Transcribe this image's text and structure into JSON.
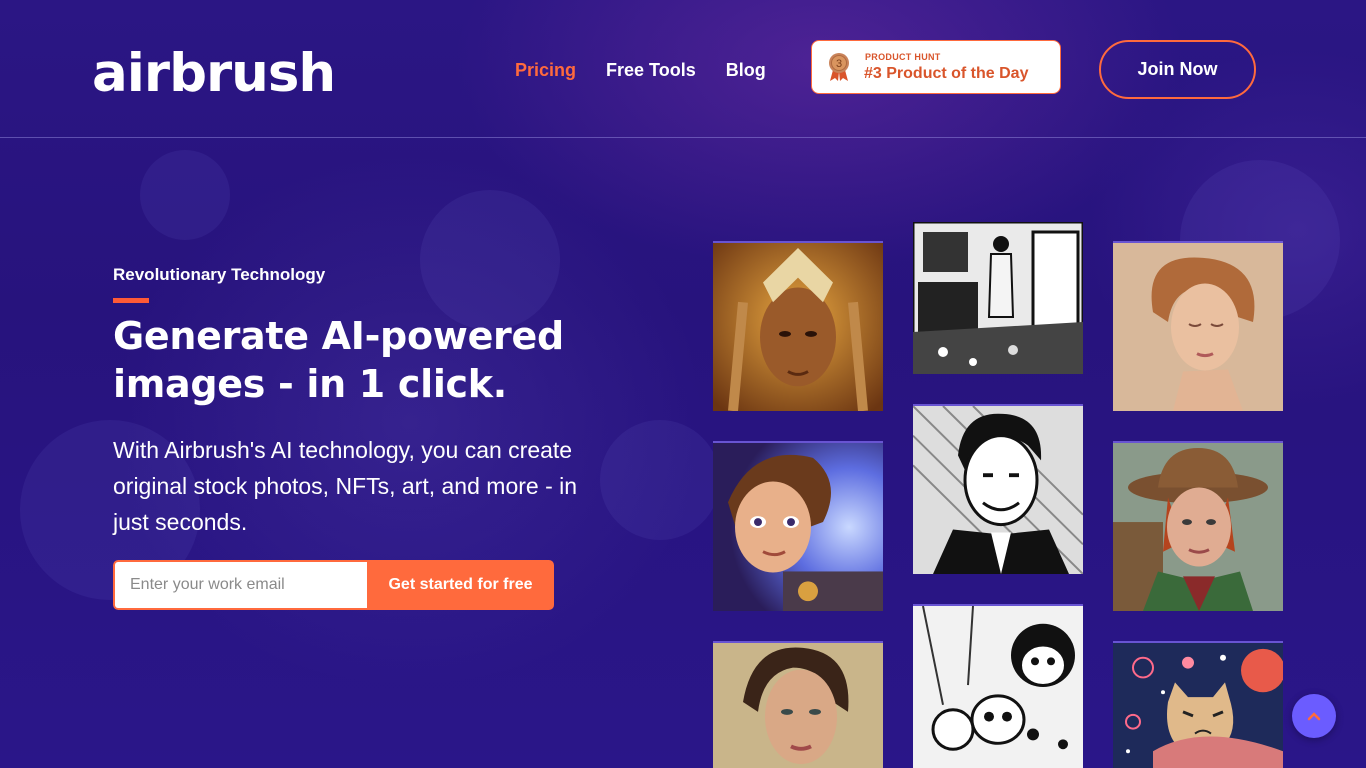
{
  "brand": {
    "logo_text": "airbrush"
  },
  "nav": {
    "items": [
      {
        "label": "Pricing",
        "active": true
      },
      {
        "label": "Free Tools",
        "active": false
      },
      {
        "label": "Blog",
        "active": false
      }
    ]
  },
  "product_hunt": {
    "kicker": "PRODUCT HUNT",
    "title": "#3 Product of the Day",
    "rank": "3"
  },
  "header_cta": {
    "label": "Join Now"
  },
  "hero": {
    "eyebrow": "Revolutionary Technology",
    "title": "Generate AI-powered images - in 1 click.",
    "subtitle": "With Airbrush's AI technology, you can create original stock photos, NFTs, art, and more - in just seconds.",
    "email_placeholder": "Enter your work email",
    "cta_label": "Get started for free"
  },
  "gallery": {
    "images": [
      {
        "name": "golden-warrior-woman-image"
      },
      {
        "name": "bw-kitchen-woman-sketch-image"
      },
      {
        "name": "redhead-woman-portrait-image"
      },
      {
        "name": "cartoon-heroine-image"
      },
      {
        "name": "bw-man-in-suit-sketch-image"
      },
      {
        "name": "woman-in-hat-image"
      },
      {
        "name": "brunette-woman-portrait-image"
      },
      {
        "name": "bw-cartoon-kids-sketch-image"
      },
      {
        "name": "grumpy-cat-fireworks-image"
      }
    ]
  },
  "colors": {
    "accent": "#ff6a3d",
    "background": "#2a1585",
    "scroll_button": "#6b5cff"
  }
}
